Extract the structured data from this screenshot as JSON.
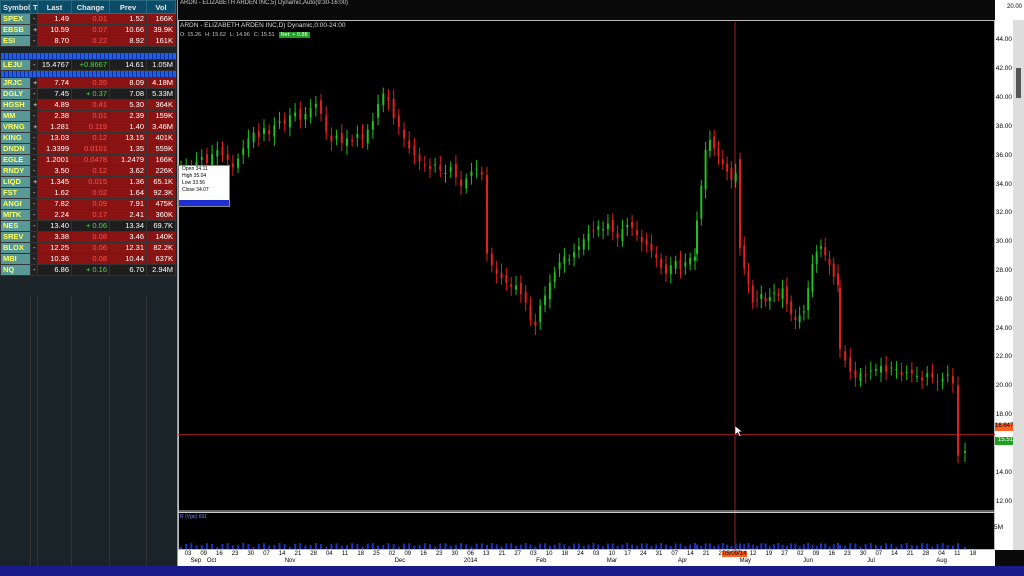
{
  "watchlist": {
    "headers": [
      "Symbol",
      "T",
      "Last",
      "Change",
      "Prev",
      "Vol"
    ],
    "group1": [
      {
        "symbol": "SPEX",
        "t": "-",
        "last": "1.49",
        "change": "0.01",
        "prev": "1.52",
        "vol": "166K",
        "style": "red"
      },
      {
        "symbol": "EBSB",
        "t": "+",
        "last": "10.59",
        "change": "0.07",
        "prev": "10.66",
        "vol": "39.9K",
        "style": "red"
      },
      {
        "symbol": "ESI",
        "t": "-",
        "last": "8.70",
        "change": "0.22",
        "prev": "8.92",
        "vol": "161K",
        "style": "red"
      }
    ],
    "group2": [
      {
        "symbol": "LEJU",
        "t": "-",
        "last": "15.4767",
        "change": "+0.8667",
        "prev": "14.61",
        "vol": "1.05M",
        "style": "dark"
      }
    ],
    "group3": [
      {
        "symbol": "JRJC",
        "t": "+",
        "last": "7.74",
        "change": "0.35",
        "prev": "8.09",
        "vol": "4.18M",
        "style": "red"
      },
      {
        "symbol": "DGLY",
        "t": "-",
        "last": "7.45",
        "change": "+ 0.37",
        "prev": "7.08",
        "vol": "5.33M",
        "style": "dark"
      },
      {
        "symbol": "HGSH",
        "t": "+",
        "last": "4.89",
        "change": "0.41",
        "prev": "5.30",
        "vol": "364K",
        "style": "red"
      },
      {
        "symbol": "MM",
        "t": "-",
        "last": "2.38",
        "change": "0.01",
        "prev": "2.39",
        "vol": "159K",
        "style": "red"
      },
      {
        "symbol": "VRNG",
        "t": "+",
        "last": "1.281",
        "change": "0.119",
        "prev": "1.40",
        "vol": "3.46M",
        "style": "red"
      },
      {
        "symbol": "KING",
        "t": "-",
        "last": "13.03",
        "change": "0.12",
        "prev": "13.15",
        "vol": "401K",
        "style": "red"
      },
      {
        "symbol": "DNDN",
        "t": "-",
        "last": "1.3399",
        "change": "0.0101",
        "prev": "1.35",
        "vol": "559K",
        "style": "red"
      },
      {
        "symbol": "EGLE",
        "t": "-",
        "last": "1.2001",
        "change": "0.0478",
        "prev": "1.2479",
        "vol": "166K",
        "style": "red"
      },
      {
        "symbol": "RNDY",
        "t": "-",
        "last": "3.50",
        "change": "0.12",
        "prev": "3.62",
        "vol": "226K",
        "style": "red"
      },
      {
        "symbol": "LIQD",
        "t": "+",
        "last": "1.345",
        "change": "0.015",
        "prev": "1.36",
        "vol": "65.1K",
        "style": "red"
      },
      {
        "symbol": "FST",
        "t": "-",
        "last": "1.62",
        "change": "0.02",
        "prev": "1.64",
        "vol": "92.3K",
        "style": "red"
      },
      {
        "symbol": "ANGI",
        "t": "-",
        "last": "7.82",
        "change": "0.09",
        "prev": "7.91",
        "vol": "475K",
        "style": "red"
      },
      {
        "symbol": "MITK",
        "t": "-",
        "last": "2.24",
        "change": "0.17",
        "prev": "2.41",
        "vol": "360K",
        "style": "red"
      },
      {
        "symbol": "NES",
        "t": "-",
        "last": "13.40",
        "change": "+ 0.06",
        "prev": "13.34",
        "vol": "69.7K",
        "style": "dark"
      },
      {
        "symbol": "SREV",
        "t": "-",
        "last": "3.38",
        "change": "0.08",
        "prev": "3.46",
        "vol": "140K",
        "style": "red"
      },
      {
        "symbol": "BLOX",
        "t": "-",
        "last": "12.25",
        "change": "0.06",
        "prev": "12.31",
        "vol": "82.2K",
        "style": "red"
      },
      {
        "symbol": "MBI",
        "t": "-",
        "last": "10.36",
        "change": "0.08",
        "prev": "10.44",
        "vol": "637K",
        "style": "red"
      },
      {
        "symbol": "NQ",
        "t": "-",
        "last": "6.86",
        "change": "+ 0.16",
        "prev": "6.70",
        "vol": "2.94M",
        "style": "dark"
      }
    ]
  },
  "chart": {
    "top_strip": "ARDN - ELIZABETH ARDEN INC,5) Dynamic,Auto(9:30-16:00)",
    "title": "ARDN - ELIZABETH ARDEN INC,D) Dynamic,0:00-24:00",
    "ohlc": {
      "o": "O: 15.26",
      "h": "H: 15.62",
      "l": "L: 14.96",
      "c": "C: 15.51",
      "badge": "Net: + 0.88"
    },
    "tooltip": [
      "Open 34.11",
      "High 35.04",
      "Low 33.56",
      "Close 34.07"
    ],
    "volume_label": "R (Vgn) 691",
    "volume_axis_label": "5M",
    "crosshair_price": "16.647",
    "last_price": "15.51",
    "crosshair_date": "05/09/14",
    "top_scale_label": "20.00"
  },
  "chart_data": {
    "type": "bar",
    "title": "ARDN - ELIZABETH ARDEN INC",
    "ylim": [
      11,
      45
    ],
    "y_ticks": [
      "44.00",
      "42.00",
      "40.00",
      "38.00",
      "36.00",
      "34.00",
      "32.00",
      "30.00",
      "28.00",
      "26.00",
      "24.00",
      "22.00",
      "20.00",
      "18.00",
      "16.00",
      "14.00",
      "12.00"
    ],
    "x_ticks": [
      "03",
      "09",
      "16",
      "23",
      "30",
      "07",
      "14",
      "21",
      "28",
      "04",
      "11",
      "18",
      "25",
      "02",
      "09",
      "16",
      "23",
      "30",
      "06",
      "13",
      "21",
      "27",
      "03",
      "10",
      "18",
      "24",
      "03",
      "10",
      "17",
      "24",
      "31",
      "07",
      "14",
      "21",
      "28",
      "05",
      "12",
      "19",
      "27",
      "02",
      "09",
      "16",
      "23",
      "30",
      "07",
      "14",
      "21",
      "28",
      "04",
      "11",
      "18"
    ],
    "month_labels": [
      "Sep",
      "Oct",
      "Nov",
      "Dec",
      "2014",
      "Feb",
      "Mar",
      "Apr",
      "May",
      "Jun",
      "Jul",
      "Aug"
    ],
    "series": [
      {
        "name": "ARDN",
        "values": [
          35.0,
          35.3,
          35.1,
          35.6,
          35.9,
          35.5,
          36.1,
          36.4,
          36.0,
          35.7,
          35.2,
          35.8,
          36.5,
          37.2,
          37.6,
          37.3,
          37.9,
          37.5,
          38.1,
          38.4,
          38.2,
          38.8,
          39.0,
          38.5,
          38.9,
          39.3,
          39.6,
          38.9,
          37.6,
          37.0,
          37.4,
          36.9,
          37.2,
          37.0,
          37.5,
          37.1,
          37.8,
          38.4,
          39.6,
          40.3,
          39.8,
          38.6,
          38.0,
          37.2,
          36.5,
          36.0,
          35.6,
          35.3,
          35.1,
          35.4,
          35.0,
          34.8,
          35.2,
          34.5,
          33.9,
          34.4,
          34.9,
          35.1,
          34.7,
          34.3,
          29.2,
          28.4,
          27.8,
          27.5,
          27.2,
          26.9,
          27.0,
          26.4,
          25.8,
          24.6,
          24.2,
          25.6,
          26.3,
          27.2,
          27.9,
          28.6,
          29.0,
          28.8,
          29.3,
          29.7,
          30.2,
          30.6,
          30.8,
          31.1,
          30.9,
          31.3,
          30.7,
          30.3,
          30.9,
          31.2,
          31.0,
          30.5,
          30.0,
          29.8,
          29.4,
          28.9,
          28.2,
          27.8,
          28.4,
          28.7,
          28.1,
          28.6,
          28.9,
          29.0,
          31.5,
          33.9,
          36.4,
          37.1,
          36.5,
          36.0,
          35.4,
          34.9,
          34.3,
          34.8,
          35.6,
          29.6,
          28.2,
          27.1,
          25.8,
          26.0,
          26.4,
          25.9,
          26.2,
          26.5,
          26.3,
          26.8,
          25.7,
          25.0,
          24.6,
          24.9,
          25.2,
          26.8,
          28.5,
          29.3,
          29.7,
          29.1,
          28.4,
          27.6,
          27.0,
          22.6,
          21.8,
          21.0,
          20.6,
          20.9,
          20.8,
          21.1,
          21.2,
          21.4,
          21.0,
          21.3,
          21.2,
          20.8,
          21.0,
          20.9,
          20.7,
          20.4,
          20.9,
          20.6,
          20.3,
          20.5,
          20.8,
          20.2,
          19.9,
          15.2,
          15.5
        ]
      }
    ]
  }
}
